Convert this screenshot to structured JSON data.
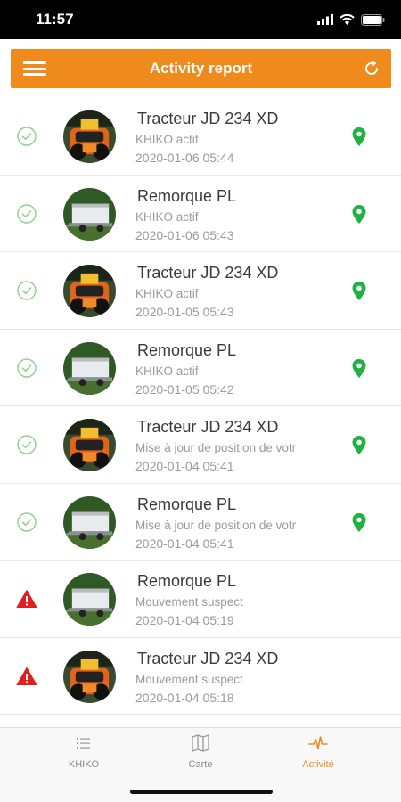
{
  "status_bar": {
    "time": "11:57"
  },
  "header": {
    "title": "Activity report"
  },
  "items": [
    {
      "title": "Tracteur JD 234 XD",
      "subtitle": "KHIKO actif",
      "timestamp": "2020-01-06 05:44",
      "status": "ok",
      "vehicle": "tractor"
    },
    {
      "title": "Remorque PL",
      "subtitle": "KHIKO actif",
      "timestamp": "2020-01-06 05:43",
      "status": "ok",
      "vehicle": "trailer"
    },
    {
      "title": "Tracteur JD 234 XD",
      "subtitle": "KHIKO actif",
      "timestamp": "2020-01-05 05:43",
      "status": "ok",
      "vehicle": "tractor"
    },
    {
      "title": "Remorque PL",
      "subtitle": "KHIKO actif",
      "timestamp": "2020-01-05 05:42",
      "status": "ok",
      "vehicle": "trailer"
    },
    {
      "title": "Tracteur JD 234 XD",
      "subtitle": "Mise à jour de position de votr",
      "timestamp": "2020-01-04 05:41",
      "status": "ok",
      "vehicle": "tractor"
    },
    {
      "title": "Remorque PL",
      "subtitle": "Mise à jour de position de votr",
      "timestamp": "2020-01-04 05:41",
      "status": "ok",
      "vehicle": "trailer"
    },
    {
      "title": "Remorque PL",
      "subtitle": "Mouvement suspect",
      "timestamp": "2020-01-04 05:19",
      "status": "alert",
      "vehicle": "trailer"
    },
    {
      "title": "Tracteur JD 234 XD",
      "subtitle": "Mouvement suspect",
      "timestamp": "2020-01-04 05:18",
      "status": "alert",
      "vehicle": "tractor"
    }
  ],
  "tabs": [
    {
      "label": "KHIKO",
      "icon": "list-icon",
      "active": false
    },
    {
      "label": "Carte",
      "icon": "map-icon",
      "active": false
    },
    {
      "label": "Activité",
      "icon": "pulse-icon",
      "active": true
    }
  ],
  "colors": {
    "accent": "#ef8a1c",
    "ok": "#8ed08a",
    "alert": "#e02020",
    "pin": "#1fb141"
  }
}
